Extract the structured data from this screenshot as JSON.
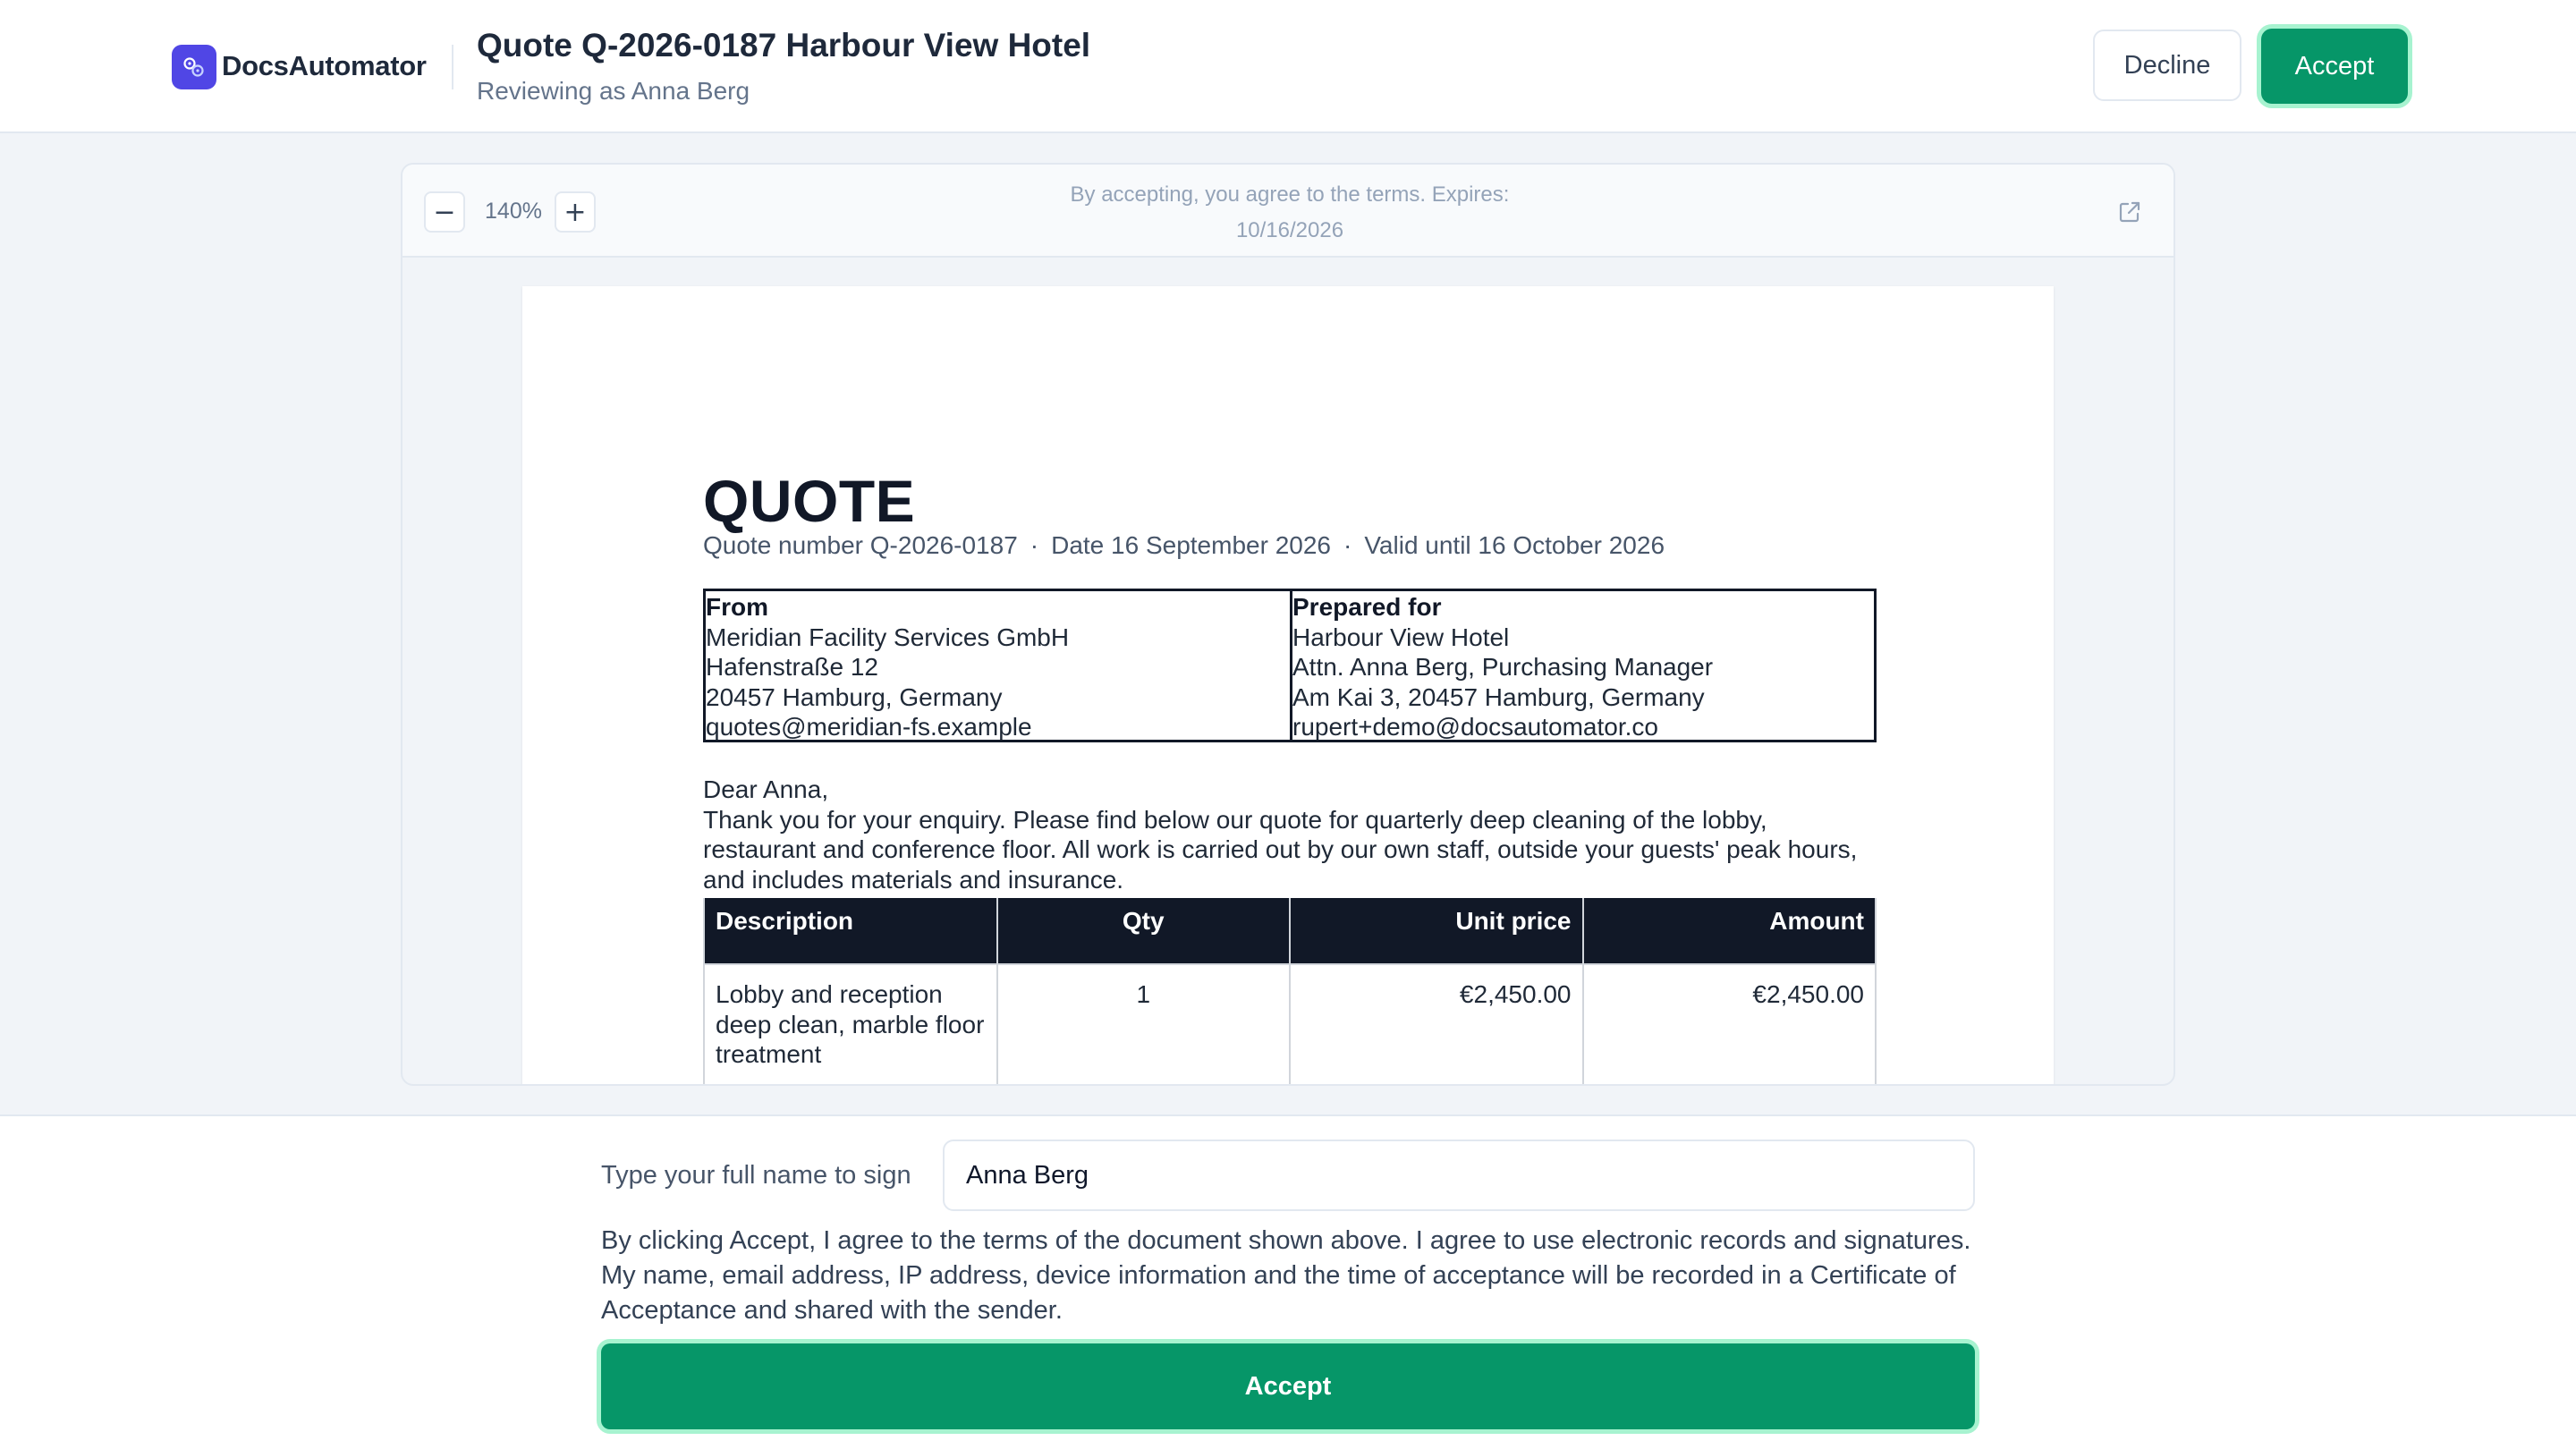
{
  "app": {
    "brand": "DocsAutomator",
    "title": "Quote Q-2026-0187 Harbour View Hotel",
    "subtitle": "Reviewing as Anna Berg",
    "decline_label": "Decline",
    "accept_label": "Accept",
    "accent_color": "#069668",
    "brand_color": "#5046e5"
  },
  "viewer": {
    "zoom_out_icon": "−",
    "zoom_in_icon": "+",
    "zoom_level": "140%",
    "notice": "By accepting, you agree to the terms. Expires: 10/16/2026",
    "open_icon": "external-link-icon"
  },
  "document": {
    "title": "QUOTE",
    "meta": {
      "number": "Quote number Q-2026-0187",
      "date": "Date 16 September 2026",
      "valid": "Valid until 16 October 2026",
      "separator": "·"
    },
    "from": {
      "heading": "From",
      "lines": [
        "Meridian Facility Services GmbH",
        "Hafenstraße 12",
        "20457 Hamburg, Germany",
        "quotes@meridian-fs.example"
      ]
    },
    "to": {
      "heading": "Prepared for",
      "lines": [
        "Harbour View Hotel",
        "Attn. Anna Berg, Purchasing Manager",
        "Am Kai 3, 20457 Hamburg, Germany",
        "rupert+demo@docsautomator.co"
      ]
    },
    "greeting": "Dear Anna,",
    "body": "Thank you for your enquiry. Please find below our quote for quarterly deep cleaning of the lobby, restaurant and conference floor. All work is carried out by our own staff, outside your guests' peak hours, and includes materials and insurance.",
    "table": {
      "headers": [
        "Description",
        "Qty",
        "Unit price",
        "Amount"
      ],
      "rows": [
        [
          "Lobby and reception deep clean, marble floor treatment",
          "1",
          "€2,450.00",
          "€2,450.00"
        ]
      ]
    }
  },
  "sign": {
    "label": "Type your full name to sign",
    "value": "Anna Berg",
    "consent": "By clicking Accept, I agree to the terms of the document shown above. I agree to use electronic records and signatures. My name, email address, IP address, device information and the time of acceptance will be recorded in a Certificate of Acceptance and shared with the sender.",
    "accept_label": "Accept"
  }
}
